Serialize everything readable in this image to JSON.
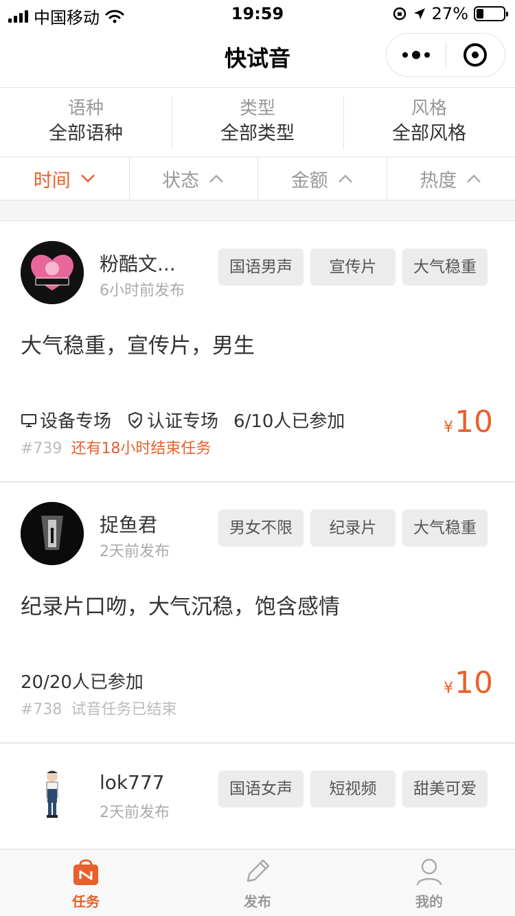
{
  "status_bar": {
    "carrier": "中国移动",
    "time": "19:59",
    "battery": "27%",
    "battery_level": 0.27
  },
  "navbar": {
    "title": "快试音"
  },
  "filters": [
    {
      "label": "语种",
      "value": "全部语种"
    },
    {
      "label": "类型",
      "value": "全部类型"
    },
    {
      "label": "风格",
      "value": "全部风格"
    }
  ],
  "sorts": [
    {
      "label": "时间",
      "direction": "down",
      "active": true
    },
    {
      "label": "状态",
      "direction": "up",
      "active": false
    },
    {
      "label": "金额",
      "direction": "up",
      "active": false
    },
    {
      "label": "热度",
      "direction": "up",
      "active": false
    }
  ],
  "tasks": [
    {
      "user": "粉酷文...",
      "posted": "6小时前发布",
      "tags": [
        "国语男声",
        "宣传片",
        "大气稳重"
      ],
      "description": "大气稳重，宣传片，男生",
      "device": "设备专场",
      "certified": "认证专场",
      "participants": "6/10人已参加",
      "id": "#739",
      "remaining": "还有18小时结束任务",
      "currency": "¥",
      "price": "10"
    },
    {
      "user": "捉鱼君",
      "posted": "2天前发布",
      "tags": [
        "男女不限",
        "纪录片",
        "大气稳重"
      ],
      "description": "纪录片口吻，大气沉稳，饱含感情",
      "participants": "20/20人已参加",
      "id": "#738",
      "ended": "试音任务已结束",
      "currency": "¥",
      "price": "10"
    },
    {
      "user": "lok777",
      "posted": "2天前发布",
      "tags": [
        "国语女声",
        "短视频",
        "甜美可爱"
      ]
    }
  ],
  "tabbar": [
    {
      "label": "任务",
      "icon": "bag-icon",
      "active": true
    },
    {
      "label": "发布",
      "icon": "pencil-icon",
      "active": false
    },
    {
      "label": "我的",
      "icon": "user-icon",
      "active": false
    }
  ],
  "colors": {
    "accent": "#e8602c",
    "muted": "#999999"
  }
}
